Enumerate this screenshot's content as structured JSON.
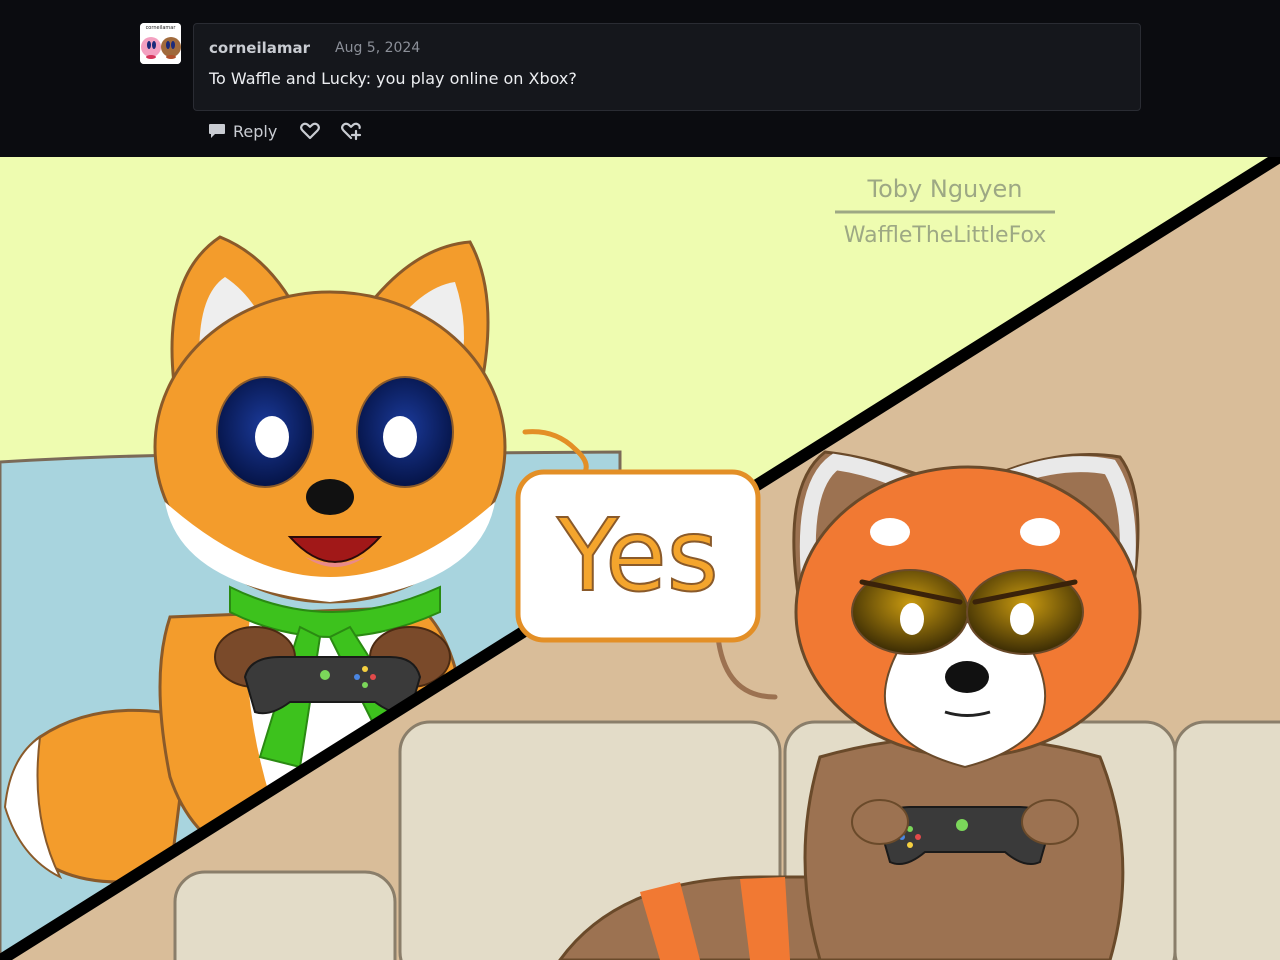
{
  "comment": {
    "author": "corneilamar",
    "date": "Aug 5, 2024",
    "body": "To Waffle and Lucky: you play online on Xbox?",
    "avatar_text": "corneilamar"
  },
  "actions": {
    "reply_label": "Reply",
    "like_icon": "heart-icon",
    "reblog_icon": "reblog-heart-icon",
    "reply_icon": "speech-bubble-icon"
  },
  "comic": {
    "speech_text": "Yes",
    "signature_name": "Toby Nguyen",
    "signature_handle": "WaffleTheLittleFox"
  },
  "colors": {
    "background": "#0b0c10",
    "card": "#15171c",
    "fox_orange": "#f39c2c",
    "panda_orange": "#f17933",
    "panel_yellow": "#eefcb0",
    "panel_tan": "#d9bd99"
  }
}
